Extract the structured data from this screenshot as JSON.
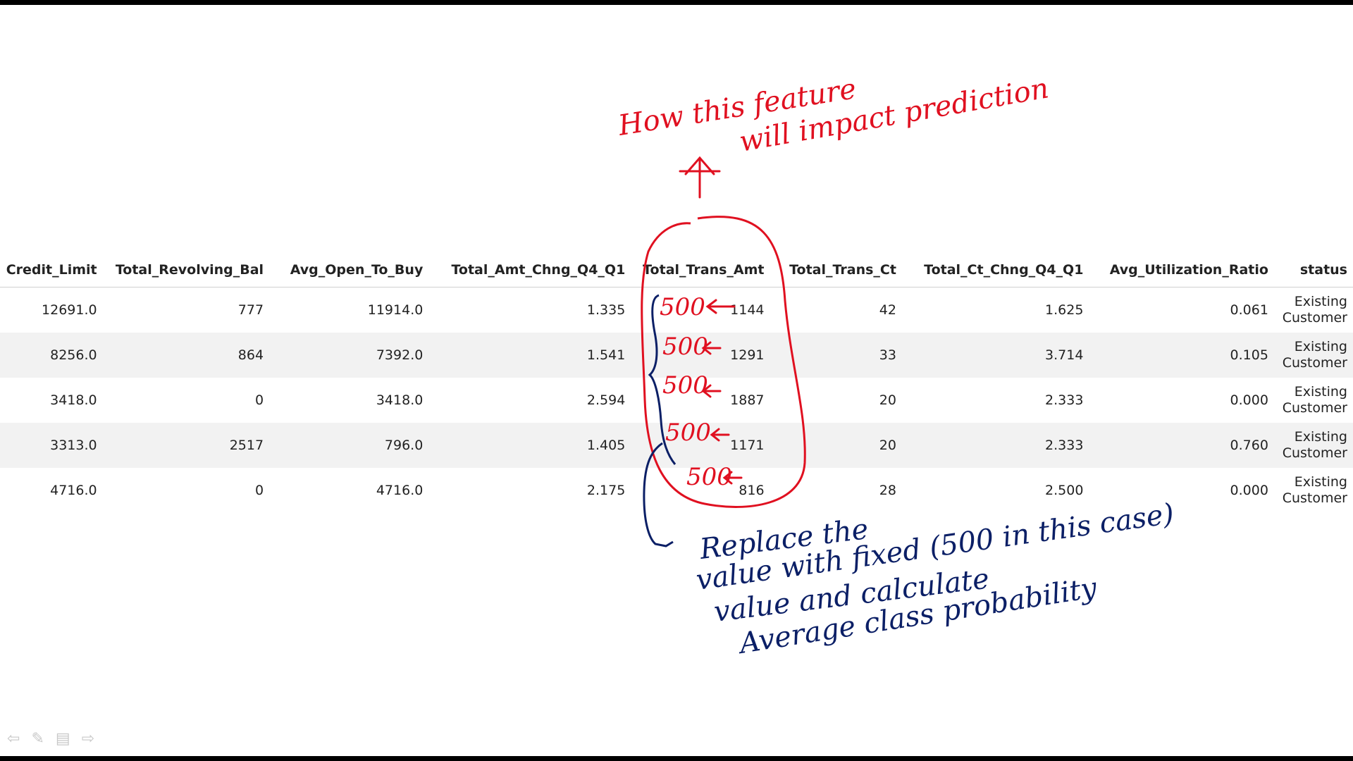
{
  "table": {
    "columns": [
      "Credit_Limit",
      "Total_Revolving_Bal",
      "Avg_Open_To_Buy",
      "Total_Amt_Chng_Q4_Q1",
      "Total_Trans_Amt",
      "Total_Trans_Ct",
      "Total_Ct_Chng_Q4_Q1",
      "Avg_Utilization_Ratio",
      "status"
    ],
    "rows": [
      {
        "Credit_Limit": "12691.0",
        "Total_Revolving_Bal": "777",
        "Avg_Open_To_Buy": "11914.0",
        "Total_Amt_Chng_Q4_Q1": "1.335",
        "Total_Trans_Amt": "1144",
        "Total_Trans_Ct": "42",
        "Total_Ct_Chng_Q4_Q1": "1.625",
        "Avg_Utilization_Ratio": "0.061",
        "status": "Existing Customer"
      },
      {
        "Credit_Limit": "8256.0",
        "Total_Revolving_Bal": "864",
        "Avg_Open_To_Buy": "7392.0",
        "Total_Amt_Chng_Q4_Q1": "1.541",
        "Total_Trans_Amt": "1291",
        "Total_Trans_Ct": "33",
        "Total_Ct_Chng_Q4_Q1": "3.714",
        "Avg_Utilization_Ratio": "0.105",
        "status": "Existing Customer"
      },
      {
        "Credit_Limit": "3418.0",
        "Total_Revolving_Bal": "0",
        "Avg_Open_To_Buy": "3418.0",
        "Total_Amt_Chng_Q4_Q1": "2.594",
        "Total_Trans_Amt": "1887",
        "Total_Trans_Ct": "20",
        "Total_Ct_Chng_Q4_Q1": "2.333",
        "Avg_Utilization_Ratio": "0.000",
        "status": "Existing Customer"
      },
      {
        "Credit_Limit": "3313.0",
        "Total_Revolving_Bal": "2517",
        "Avg_Open_To_Buy": "796.0",
        "Total_Amt_Chng_Q4_Q1": "1.405",
        "Total_Trans_Amt": "1171",
        "Total_Trans_Ct": "20",
        "Total_Ct_Chng_Q4_Q1": "2.333",
        "Avg_Utilization_Ratio": "0.760",
        "status": "Existing Customer"
      },
      {
        "Credit_Limit": "4716.0",
        "Total_Revolving_Bal": "0",
        "Avg_Open_To_Buy": "4716.0",
        "Total_Amt_Chng_Q4_Q1": "2.175",
        "Total_Trans_Amt": "816",
        "Total_Trans_Ct": "28",
        "Total_Ct_Chng_Q4_Q1": "2.500",
        "Avg_Utilization_Ratio": "0.000",
        "status": "Existing Customer"
      }
    ]
  },
  "annotations": {
    "top_note_line1": "How this feature",
    "top_note_line2": "will impact prediction",
    "replacement_values": [
      "500",
      "500",
      "500",
      "500",
      "500"
    ],
    "bottom_note_line1": "Replace the",
    "bottom_note_line2": "value with fixed (500 in this case)",
    "bottom_note_line3": "value and calculate",
    "bottom_note_line4": "Average class probability",
    "colors": {
      "red_ink": "#e01020",
      "blue_ink": "#0b1f66"
    }
  },
  "slide_tools": {
    "icons": [
      "back-arrow-icon",
      "pen-icon",
      "menu-icon",
      "forward-arrow-icon"
    ],
    "back": "⇦",
    "pen": "✎",
    "menu": "▤",
    "forward": "⇨"
  }
}
